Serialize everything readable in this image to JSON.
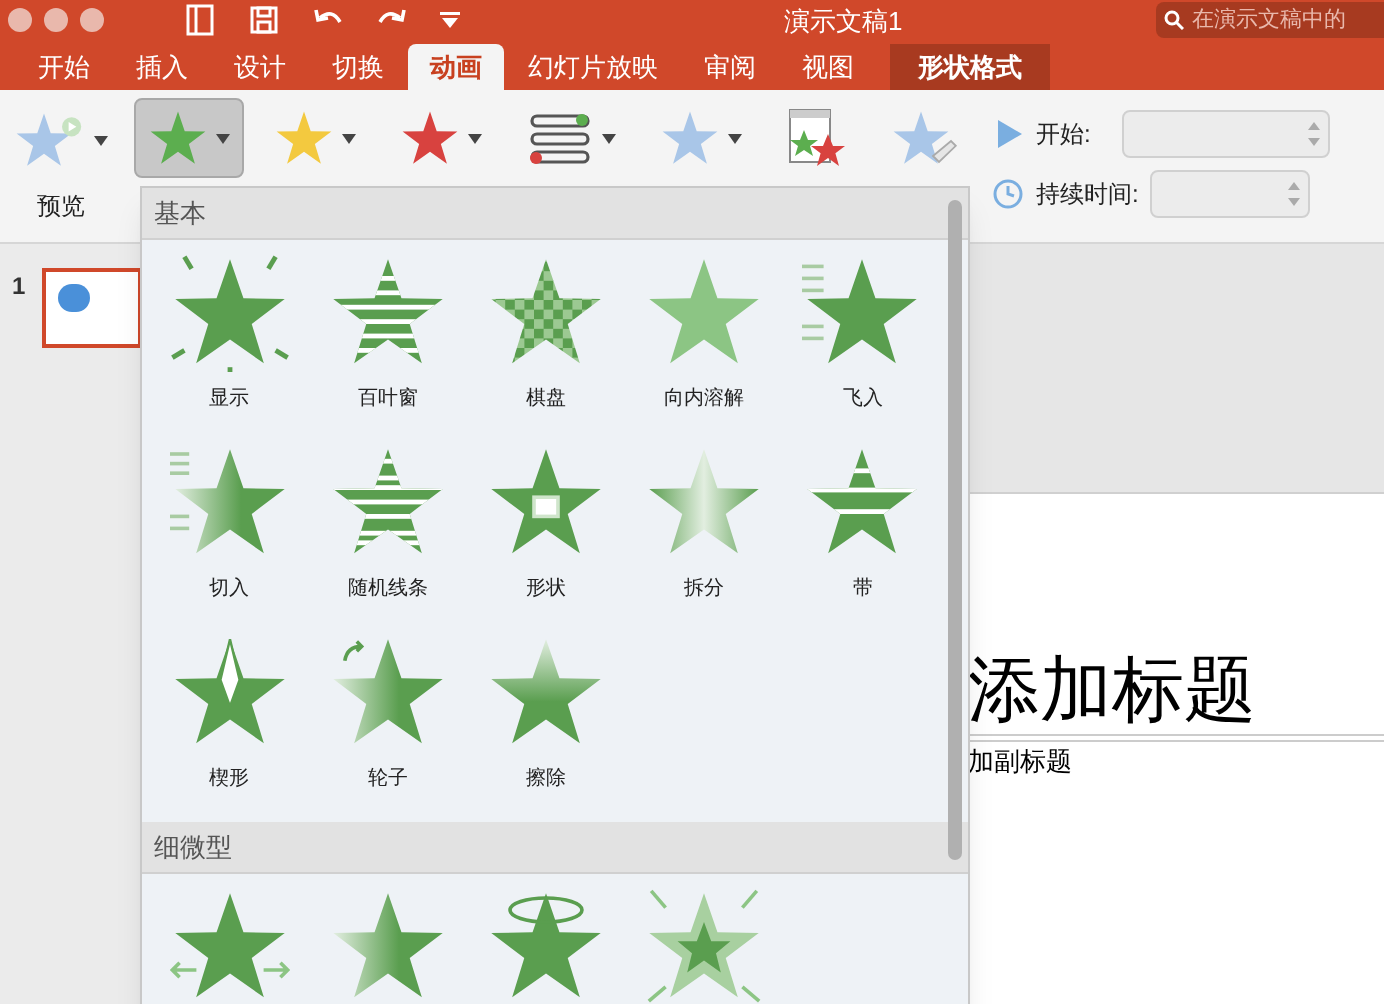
{
  "window": {
    "title": "演示文稿1"
  },
  "search": {
    "placeholder": "在演示文稿中的"
  },
  "tabs": [
    {
      "label": "开始",
      "selected": false,
      "contextual": false
    },
    {
      "label": "插入",
      "selected": false,
      "contextual": false
    },
    {
      "label": "设计",
      "selected": false,
      "contextual": false
    },
    {
      "label": "切换",
      "selected": false,
      "contextual": false
    },
    {
      "label": "动画",
      "selected": true,
      "contextual": false
    },
    {
      "label": "幻灯片放映",
      "selected": false,
      "contextual": false
    },
    {
      "label": "审阅",
      "selected": false,
      "contextual": false
    },
    {
      "label": "视图",
      "selected": false,
      "contextual": false
    },
    {
      "label": "形状格式",
      "selected": false,
      "contextual": true
    }
  ],
  "tools": [
    {
      "kind": "preview",
      "label": "预览",
      "selected": false
    },
    {
      "kind": "entrance",
      "selected": true
    },
    {
      "kind": "emphasis",
      "selected": false
    },
    {
      "kind": "exit",
      "selected": false
    },
    {
      "kind": "options",
      "selected": false
    },
    {
      "kind": "add",
      "selected": false
    },
    {
      "kind": "pane",
      "selected": false
    },
    {
      "kind": "painter",
      "selected": false
    }
  ],
  "timing": [
    {
      "kind": "start",
      "label": "开始:"
    },
    {
      "kind": "duration",
      "label": "持续时间:"
    }
  ],
  "thumbnails": [
    {
      "number": "1",
      "selected": true
    }
  ],
  "slide": {
    "title": "添加标题",
    "subtitle": "加副标题"
  },
  "gallery": {
    "sections": [
      {
        "title": "基本",
        "items": [
          {
            "label": "显示",
            "kind": "appear"
          },
          {
            "label": "百叶窗",
            "kind": "blinds"
          },
          {
            "label": "棋盘",
            "kind": "checkerboard"
          },
          {
            "label": "向内溶解",
            "kind": "dissolve"
          },
          {
            "label": "飞入",
            "kind": "fly"
          },
          {
            "label": "切入",
            "kind": "cut"
          },
          {
            "label": "随机线条",
            "kind": "bars"
          },
          {
            "label": "形状",
            "kind": "shape"
          },
          {
            "label": "拆分",
            "kind": "split"
          },
          {
            "label": "带",
            "kind": "strips"
          },
          {
            "label": "楔形",
            "kind": "wedge"
          },
          {
            "label": "轮子",
            "kind": "wheel"
          },
          {
            "label": "擦除",
            "kind": "wipe"
          }
        ]
      },
      {
        "title": "细微型",
        "items": [
          {
            "kind": "stretch"
          },
          {
            "kind": "fade"
          },
          {
            "kind": "spin"
          },
          {
            "kind": "grow"
          }
        ]
      }
    ]
  }
}
